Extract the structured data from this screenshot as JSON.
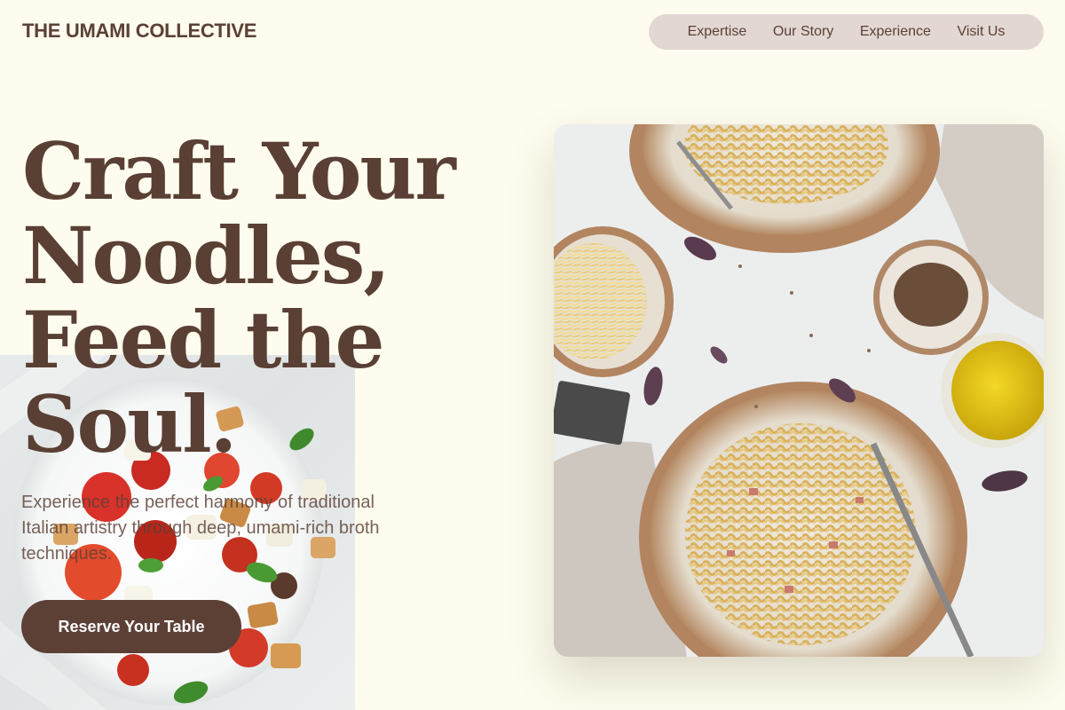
{
  "brand": {
    "name": "THE UMAMI COLLECTIVE"
  },
  "nav": {
    "items": [
      {
        "label": "Expertise"
      },
      {
        "label": "Our Story"
      },
      {
        "label": "Experience"
      },
      {
        "label": "Visit Us"
      }
    ]
  },
  "hero": {
    "title_lines": [
      "Craft Your",
      "Noodles,",
      "Feed the",
      "Soul."
    ],
    "subtitle": "Experience the perfect harmony of traditional Italian artistry through deep, umami-rich broth techniques.",
    "cta_label": "Reserve Your Table"
  },
  "colors": {
    "background": "#fdfcee",
    "text": "#5c4036",
    "nav_pill": "#e2d7d3",
    "button": "#5c4036"
  },
  "images": [
    {
      "name": "salad-photo",
      "depicts": "caprese salad on white plate"
    },
    {
      "name": "pasta-photo",
      "depicts": "carbonara pasta bowls with olive oil, cheese and spices"
    }
  ]
}
